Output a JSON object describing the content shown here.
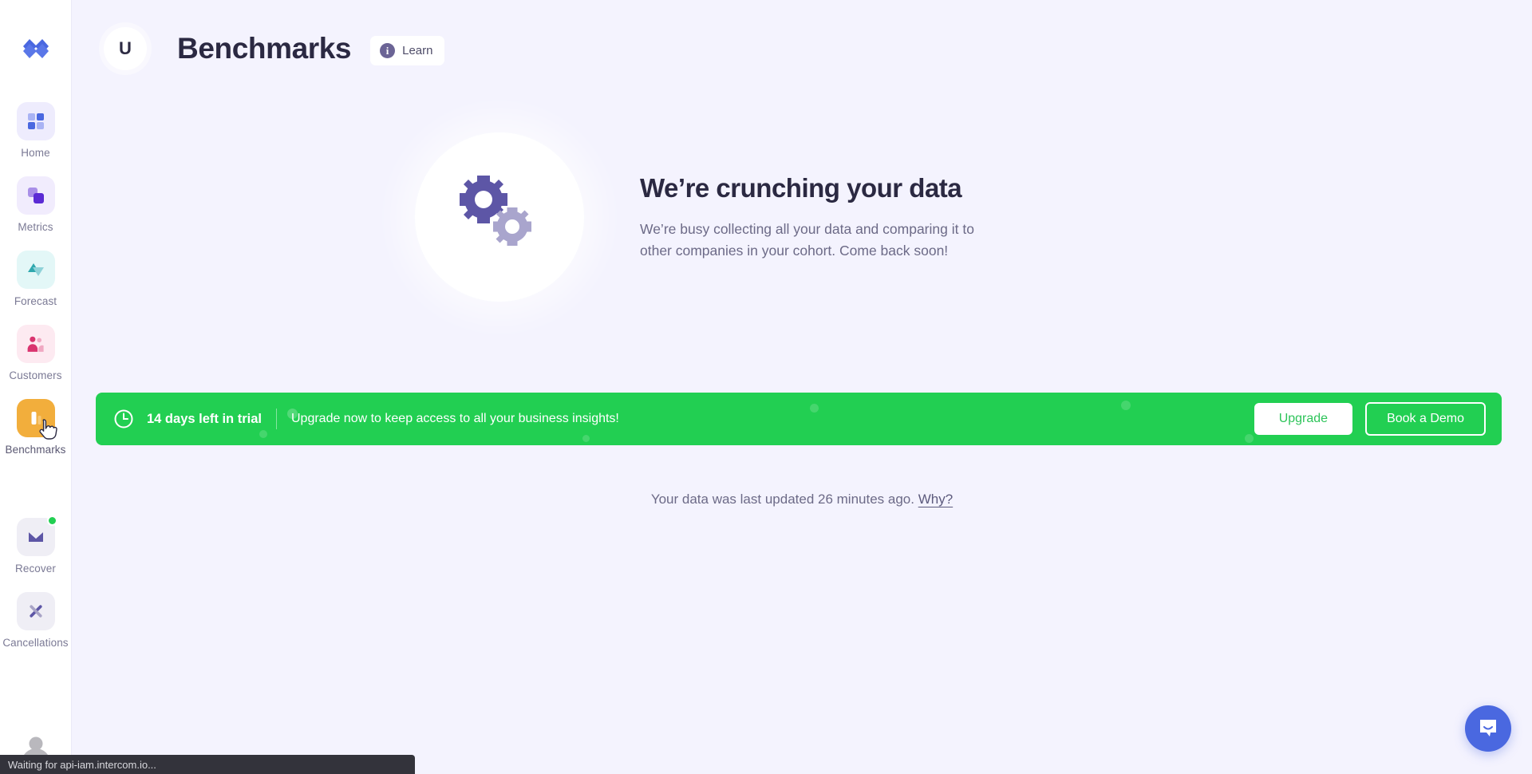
{
  "brand": {
    "logo_icon": "baremetrics-logo-icon",
    "accent": "#4a68e0"
  },
  "sidebar": {
    "items": [
      {
        "label": "Home",
        "icon": "grid-squares-icon",
        "active": false,
        "badge": false
      },
      {
        "label": "Metrics",
        "icon": "layered-squares-icon",
        "active": false,
        "badge": false
      },
      {
        "label": "Forecast",
        "icon": "triangles-icon",
        "active": false,
        "badge": false
      },
      {
        "label": "Customers",
        "icon": "people-icon",
        "active": false,
        "badge": false
      },
      {
        "label": "Benchmarks",
        "icon": "bar-chart-icon",
        "active": true,
        "badge": false
      },
      {
        "label": "Recover",
        "icon": "envelope-icon",
        "active": false,
        "badge": true
      },
      {
        "label": "Cancellations",
        "icon": "scissors-x-icon",
        "active": false,
        "badge": false
      }
    ],
    "avatar_icon": "user-avatar-icon",
    "badge_color": "#22cf52",
    "active_tile_color": "#f2ae3c"
  },
  "header": {
    "account_initial": "U",
    "title": "Benchmarks",
    "learn_chip": {
      "label": "Learn",
      "icon": "info-icon"
    }
  },
  "empty_state": {
    "illustration_icon": "two-gears-icon",
    "title": "We’re crunching your data",
    "subtitle": "We’re busy collecting all your data and comparing it to other companies in your cohort. Come back soon!"
  },
  "trial_banner": {
    "icon": "clock-icon",
    "days_left": "14 days left in trial",
    "message": "Upgrade now to keep access to all your business insights!",
    "upgrade_label": "Upgrade",
    "demo_label": "Book a Demo",
    "background": "#22cf52"
  },
  "footer": {
    "updated_text": "Your data was last updated 26 minutes ago.",
    "why_label": "Why?"
  },
  "intercom": {
    "icon": "chat-bubble-icon"
  },
  "status_bar": {
    "text": "Waiting for api-iam.intercom.io..."
  }
}
